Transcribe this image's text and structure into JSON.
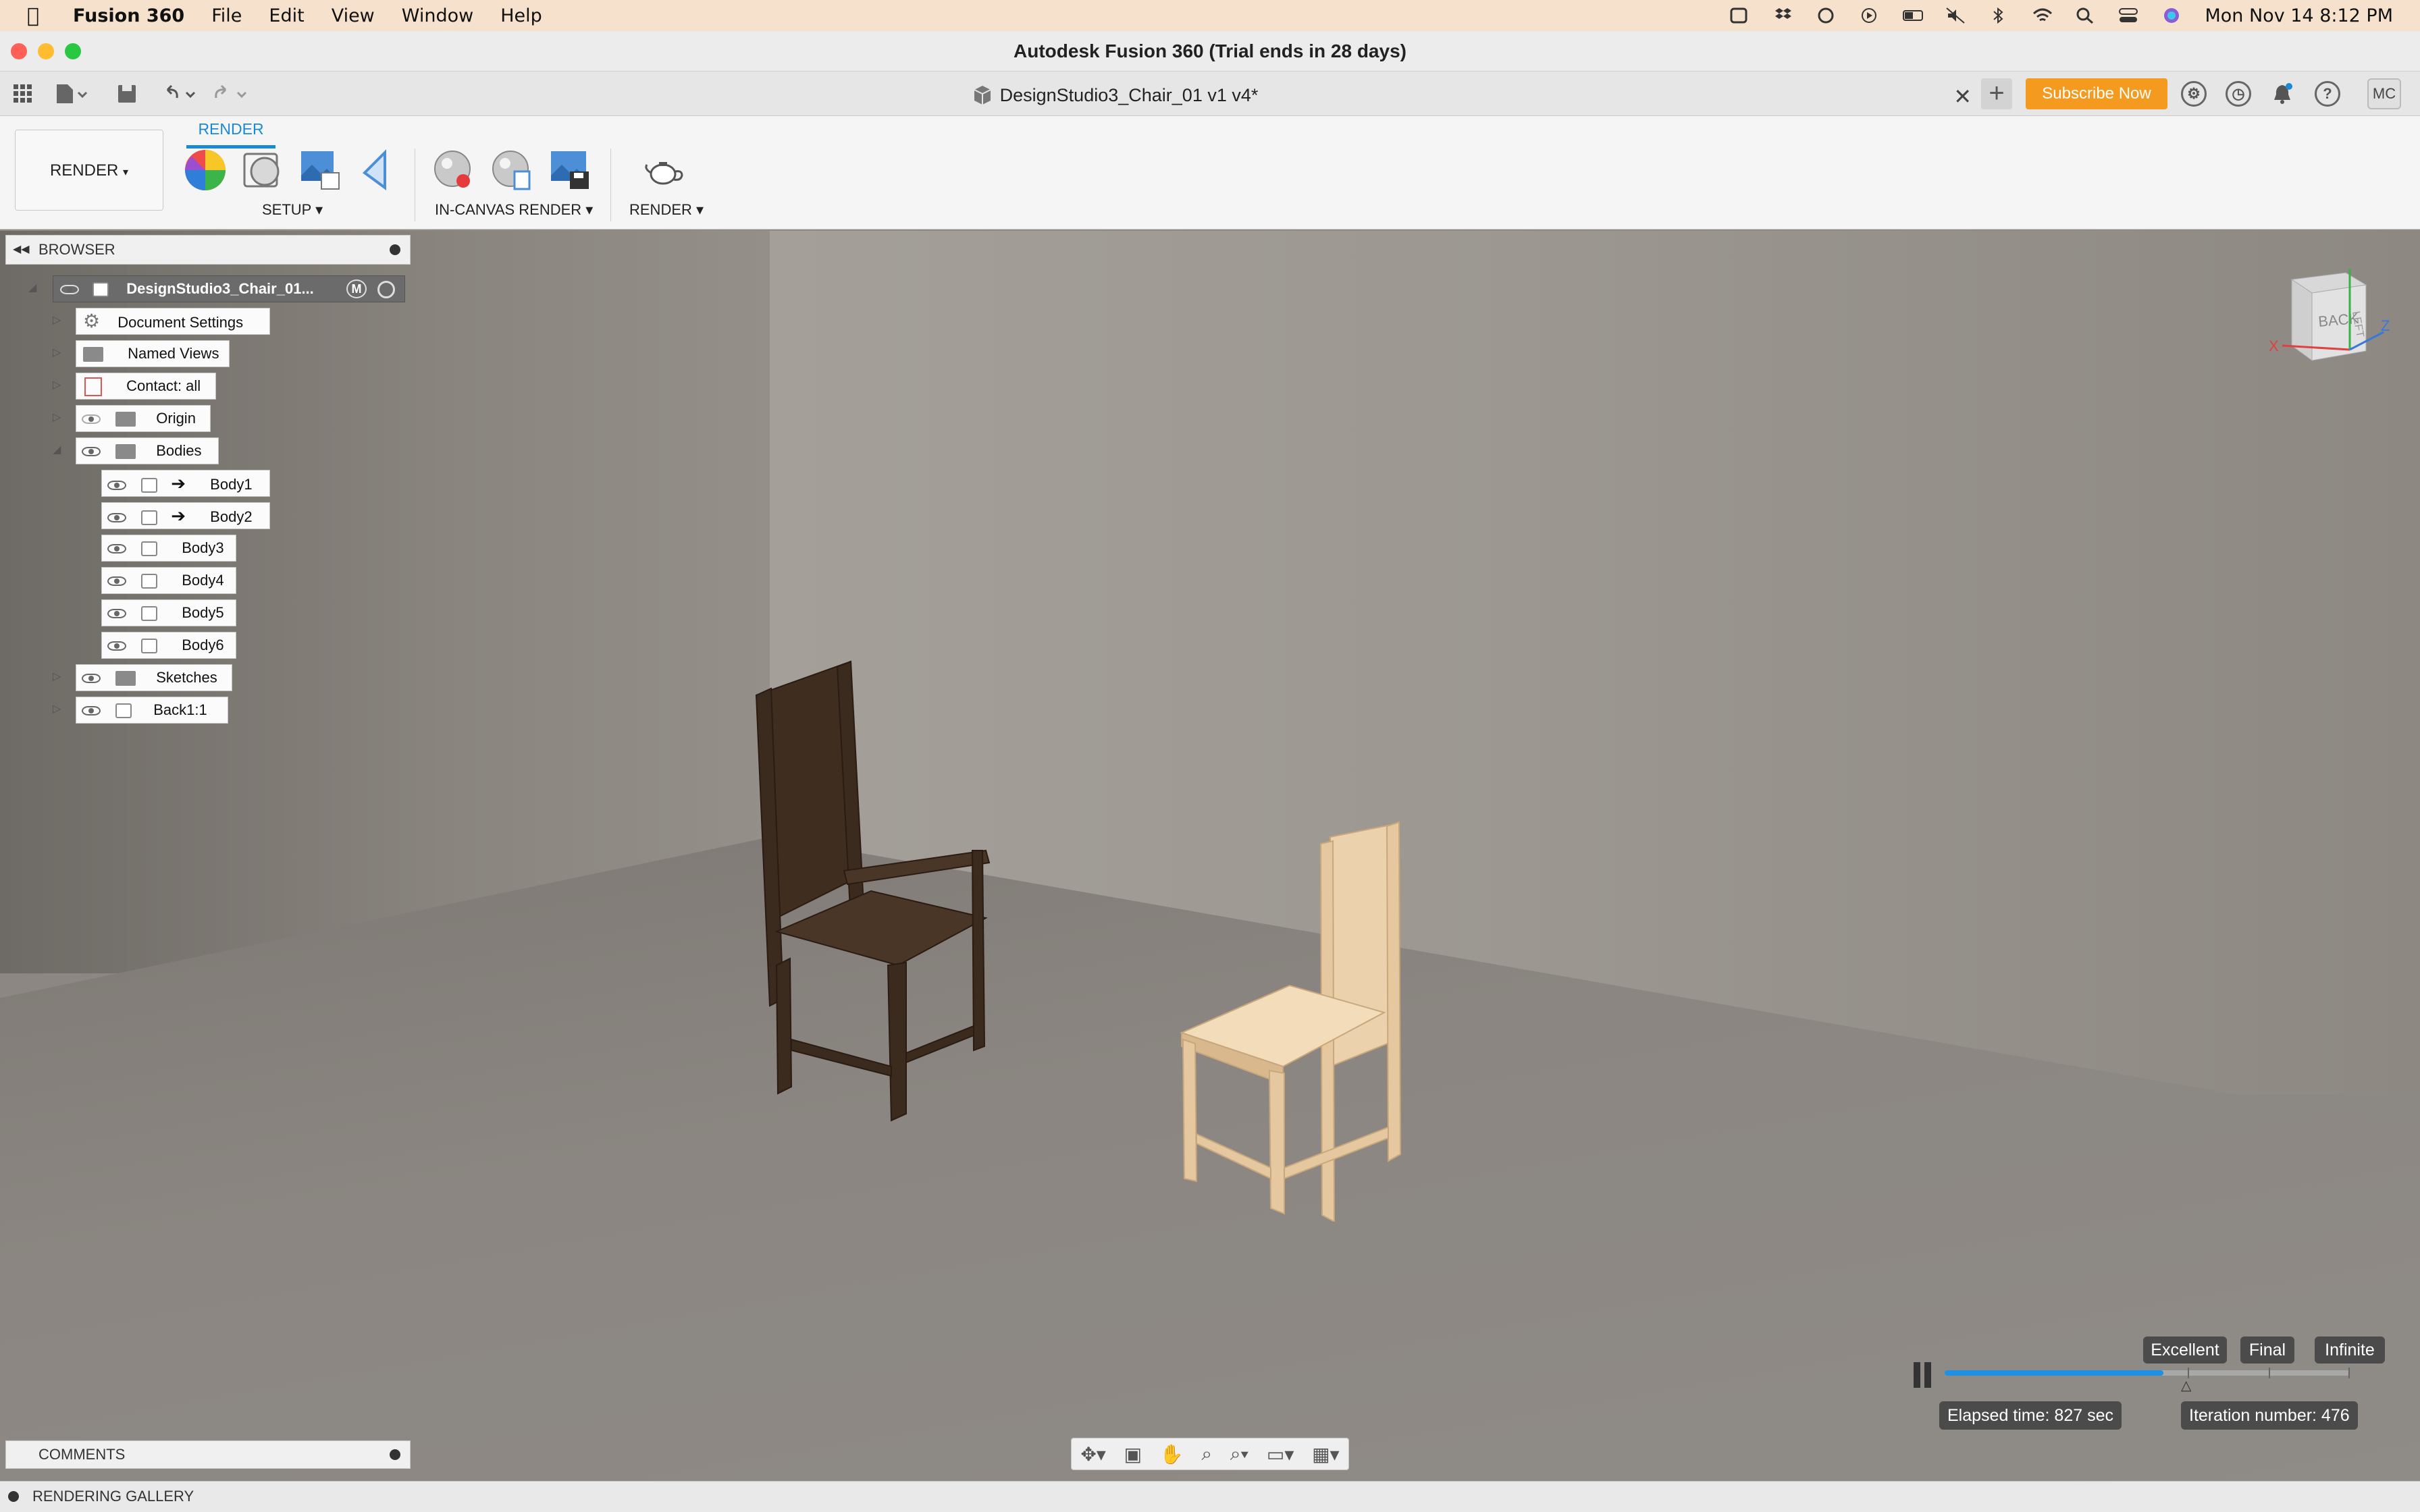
{
  "menubar": {
    "app_name": "Fusion 360",
    "items": [
      "File",
      "Edit",
      "View",
      "Window",
      "Help"
    ],
    "clock": "Mon Nov 14  8:12 PM"
  },
  "window": {
    "title": "Autodesk Fusion 360 (Trial ends in 28 days)"
  },
  "document": {
    "tab_title": "DesignStudio3_Chair_01 v1 v4*"
  },
  "header": {
    "subscribe_label": "Subscribe Now",
    "user_initials": "MC"
  },
  "ribbon": {
    "workspace": "RENDER",
    "active_tab": "RENDER",
    "groups": {
      "setup": "SETUP",
      "in_canvas": "IN-CANVAS RENDER",
      "render": "RENDER"
    }
  },
  "browser": {
    "title": "BROWSER",
    "root": "DesignStudio3_Chair_01...",
    "root_badge": "M",
    "nodes": {
      "doc_settings": "Document Settings",
      "named_views": "Named Views",
      "contact": "Contact: all",
      "origin": "Origin",
      "bodies": "Bodies",
      "body1": "Body1",
      "body2": "Body2",
      "body3": "Body3",
      "body4": "Body4",
      "body5": "Body5",
      "body6": "Body6",
      "sketches": "Sketches",
      "back": "Back1:1"
    }
  },
  "viewcube": {
    "face": "BACK",
    "side": "LEFT",
    "axis_x": "X",
    "axis_z": "Z"
  },
  "render_controls": {
    "quality_levels": [
      "Excellent",
      "Final",
      "Infinite"
    ],
    "progress": 0.54,
    "elapsed": "Elapsed time: 827 sec",
    "iteration": "Iteration number: 476"
  },
  "panels": {
    "comments": "COMMENTS",
    "gallery": "RENDERING GALLERY"
  },
  "colors": {
    "accent": "#1b8ad6",
    "subscribe": "#f39a1f"
  }
}
